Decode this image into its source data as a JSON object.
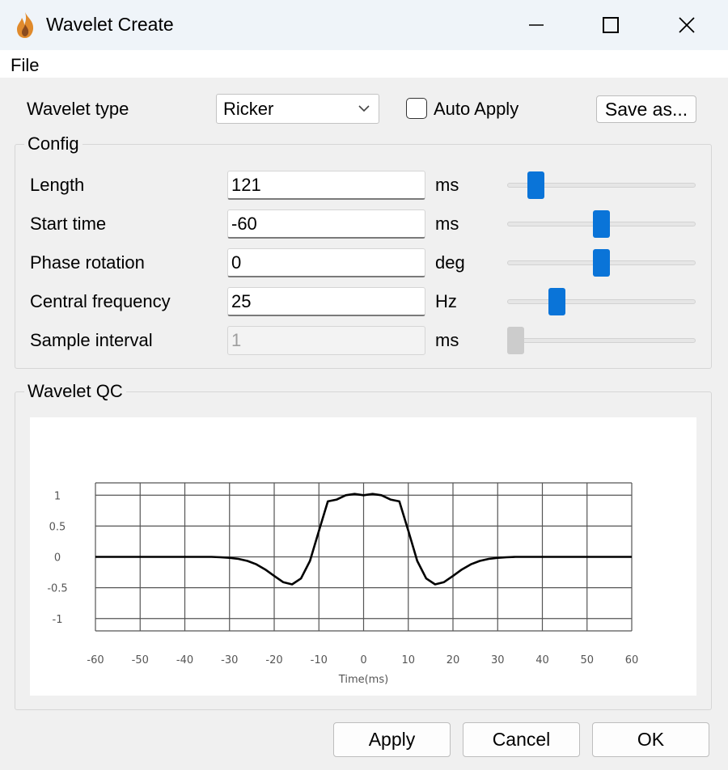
{
  "window": {
    "title": "Wavelet Create",
    "icon": "flame-icon",
    "controls": [
      "minimize-icon",
      "maximize-icon",
      "close-icon"
    ]
  },
  "menu": {
    "file": "File"
  },
  "header": {
    "wavelet_type_label": "Wavelet type",
    "wavelet_type_value": "Ricker",
    "auto_apply_label": "Auto Apply",
    "auto_apply_checked": false,
    "save_as_label": "Save as..."
  },
  "config": {
    "title": "Config",
    "rows": [
      {
        "label": "Length",
        "value": "121",
        "unit": "ms",
        "slider": 0.12,
        "enabled": true
      },
      {
        "label": "Start time",
        "value": "-60",
        "unit": "ms",
        "slider": 0.5,
        "enabled": true
      },
      {
        "label": "Phase rotation",
        "value": "0",
        "unit": "deg",
        "slider": 0.5,
        "enabled": true
      },
      {
        "label": "Central frequency",
        "value": "25",
        "unit": "Hz",
        "slider": 0.24,
        "enabled": true
      },
      {
        "label": "Sample interval",
        "value": "1",
        "unit": "ms",
        "slider": 0.0,
        "enabled": false
      }
    ]
  },
  "qc": {
    "title": "Wavelet QC"
  },
  "chart_data": {
    "type": "line",
    "title": "",
    "xlabel": "Time(ms)",
    "ylabel": "",
    "xlim": [
      -60,
      60
    ],
    "ylim": [
      -1.2,
      1.2
    ],
    "x_ticks": [
      -60,
      -50,
      -40,
      -30,
      -20,
      -10,
      0,
      10,
      20,
      30,
      40,
      50,
      60
    ],
    "y_ticks": [
      "1",
      "0.5",
      "0",
      "-0.5",
      "-1"
    ],
    "grid": true,
    "series": [
      {
        "color": "#000000",
        "x": [
          -60,
          -34,
          -32,
          -30,
          -28,
          -26,
          -24,
          -22,
          -20,
          -18,
          -16,
          -14,
          -12,
          -10,
          -8,
          -6,
          -4,
          -2,
          0,
          2,
          4,
          6,
          8,
          10,
          12,
          14,
          16,
          18,
          20,
          22,
          24,
          26,
          28,
          30,
          32,
          34,
          60
        ],
        "y": [
          0,
          0,
          -0.007,
          -0.016,
          -0.033,
          -0.066,
          -0.121,
          -0.204,
          -0.31,
          -0.409,
          -0.446,
          -0.35,
          -0.066,
          0.423,
          0.9,
          0.93,
          1.0,
          1.02,
          1.0,
          1.02,
          1.0,
          0.93,
          0.9,
          0.423,
          -0.066,
          -0.35,
          -0.446,
          -0.409,
          -0.31,
          -0.204,
          -0.121,
          -0.066,
          -0.033,
          -0.016,
          -0.007,
          0,
          0
        ]
      }
    ]
  },
  "footer": {
    "apply": "Apply",
    "cancel": "Cancel",
    "ok": "OK"
  }
}
